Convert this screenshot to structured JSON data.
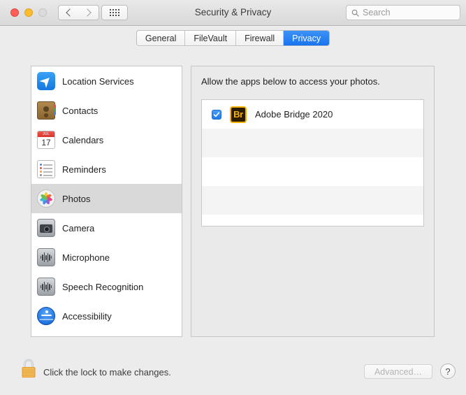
{
  "window": {
    "title": "Security & Privacy",
    "traffic_lights": [
      {
        "name": "close",
        "color": "#ff5f57",
        "enabled": true
      },
      {
        "name": "minimize",
        "color": "#ffbd2e",
        "enabled": true
      },
      {
        "name": "zoom",
        "color": "#dcdcdc",
        "enabled": false
      }
    ]
  },
  "toolbar": {
    "back_icon": "chevron-left-icon",
    "forward_icon": "chevron-right-icon",
    "show_all_icon": "grid-icon",
    "search": {
      "placeholder": "Search",
      "value": "",
      "icon": "search-icon"
    }
  },
  "tabs": [
    {
      "label": "General",
      "active": false
    },
    {
      "label": "FileVault",
      "active": false
    },
    {
      "label": "Firewall",
      "active": false
    },
    {
      "label": "Privacy",
      "active": true
    }
  ],
  "sidebar": {
    "items": [
      {
        "label": "Location Services",
        "icon": "location-services-icon",
        "selected": false
      },
      {
        "label": "Contacts",
        "icon": "contacts-icon",
        "selected": false
      },
      {
        "label": "Calendars",
        "icon": "calendars-icon",
        "selected": false,
        "calendar_month": "JUL",
        "calendar_day": "17"
      },
      {
        "label": "Reminders",
        "icon": "reminders-icon",
        "selected": false
      },
      {
        "label": "Photos",
        "icon": "photos-icon",
        "selected": true
      },
      {
        "label": "Camera",
        "icon": "camera-icon",
        "selected": false
      },
      {
        "label": "Microphone",
        "icon": "microphone-icon",
        "selected": false
      },
      {
        "label": "Speech Recognition",
        "icon": "speech-recognition-icon",
        "selected": false
      },
      {
        "label": "Accessibility",
        "icon": "accessibility-icon",
        "selected": false
      }
    ]
  },
  "detail": {
    "description": "Allow the apps below to access your photos.",
    "apps": [
      {
        "name": "Adobe Bridge 2020",
        "checked": true,
        "icon_text": "Br",
        "icon_bg": "#2b1c02",
        "icon_border": "#f5b400",
        "icon_fg": "#f5b400"
      }
    ],
    "empty_row_count": 4
  },
  "footer": {
    "lock_icon": "lock-icon",
    "lock_state": "unlocked",
    "lock_message": "Click the lock to make changes.",
    "advanced_label": "Advanced…",
    "advanced_enabled": false,
    "help_label": "?"
  },
  "colors": {
    "accent": "#1a74ee",
    "selection": "#d9d9d9",
    "window_bg": "#ececec",
    "pane_bg": "#eaeaea"
  }
}
